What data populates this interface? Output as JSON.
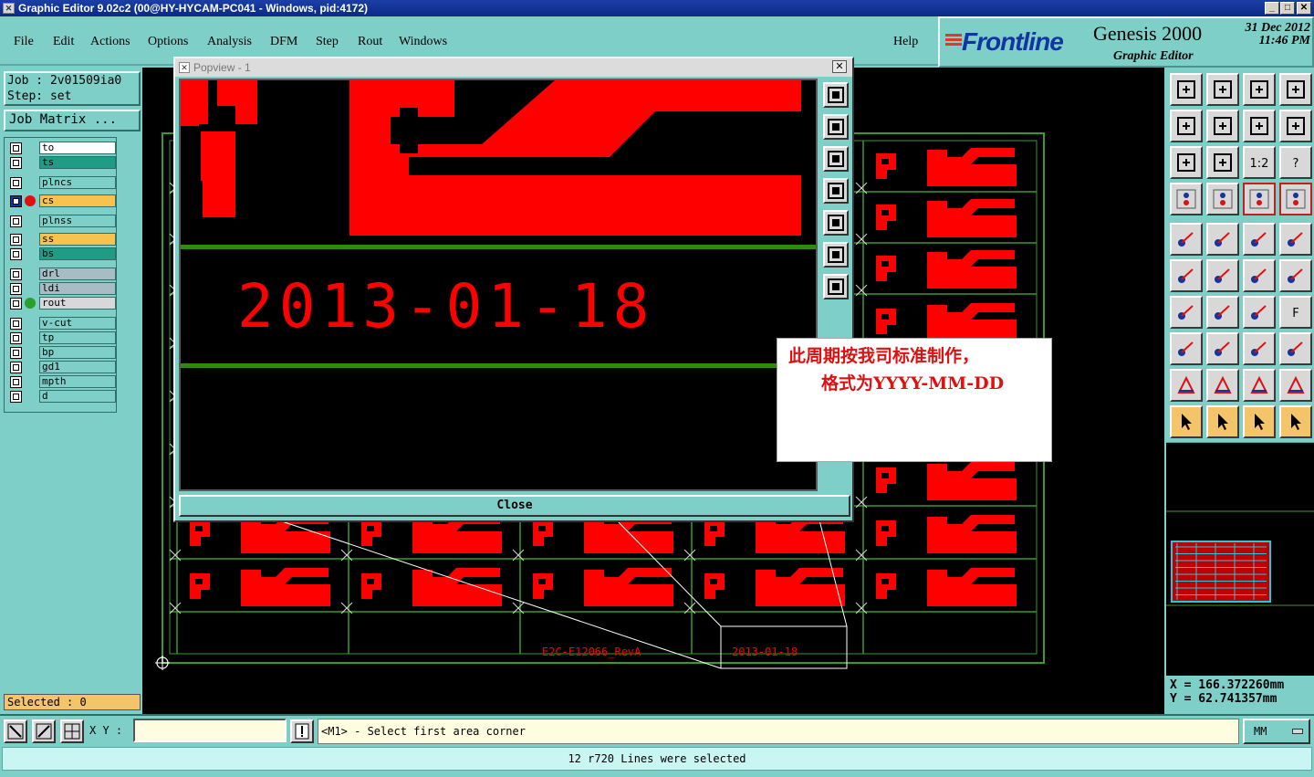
{
  "window": {
    "title": "Graphic Editor 9.02c2 (00@HY-HYCAM-PC041 - Windows, pid:4172)",
    "controls": [
      "_",
      "□",
      "✕"
    ]
  },
  "menu": {
    "items": [
      "File",
      "Edit",
      "Actions",
      "Options",
      "Analysis",
      "DFM",
      "Step",
      "Rout",
      "Windows"
    ],
    "help": "Help"
  },
  "brand": {
    "logo": "Frontline",
    "product": "Genesis 2000",
    "date": "31 Dec 2012",
    "time": "11:46 PM",
    "subtitle": "Graphic Editor"
  },
  "job": {
    "job_line": "Job : 2v01509ia0",
    "step_line": "Step: set",
    "matrix_button": "Job Matrix ..."
  },
  "layers": [
    {
      "name": "to",
      "color": "#ffffff"
    },
    {
      "name": "ts",
      "color": "#1f9c84"
    },
    {
      "name": "plncs",
      "color": "#7ecfc8"
    },
    {
      "name": "cs",
      "color": "#f7c24e",
      "dot": "#e01010"
    },
    {
      "name": "plnss",
      "color": "#7ecfc8"
    },
    {
      "name": "ss",
      "color": "#f7c24e"
    },
    {
      "name": "bs",
      "color": "#1f9c84"
    },
    {
      "name": "drl",
      "color": "#a8bcc4"
    },
    {
      "name": "ldi",
      "color": "#a8bcc4"
    },
    {
      "name": "rout",
      "color": "#d8d8d8",
      "dot": "#2aa02a"
    },
    {
      "name": "v-cut",
      "color": "#7ecfc8"
    },
    {
      "name": "tp",
      "color": "#7ecfc8"
    },
    {
      "name": "bp",
      "color": "#7ecfc8"
    },
    {
      "name": "gd1",
      "color": "#7ecfc8"
    },
    {
      "name": "mpth",
      "color": "#7ecfc8"
    },
    {
      "name": "d",
      "color": "#7ecfc8"
    }
  ],
  "selected": "Selected : 0",
  "canvas": {
    "label_part": "E2C-E12066_RevA",
    "label_date": "2013-01-18"
  },
  "popview": {
    "title": "Popview - 1",
    "big_date": "2013-01-18",
    "close_label": "Close"
  },
  "note": {
    "line1": "此周期按我司标准制作，",
    "line2": "格式为YYYY-MM-DD"
  },
  "coords": {
    "x": "X =  166.372260mm",
    "y": "Y =  62.741357mm"
  },
  "command": {
    "xy_label": "X Y :",
    "prompt": "<M1> - Select first area corner",
    "units": "MM"
  },
  "status": "12 r720 Lines were selected",
  "colors": {
    "panel": "#7ecfc8",
    "copper": "#ff0000",
    "outline": "#3a9a2a",
    "title": "#0a2a86"
  }
}
